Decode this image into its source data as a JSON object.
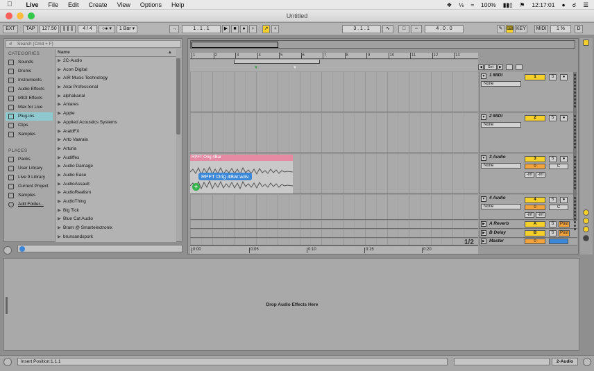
{
  "menubar": {
    "apple": "",
    "app": "Live",
    "items": [
      "File",
      "Edit",
      "Create",
      "View",
      "Options",
      "Help"
    ],
    "battery": "100%",
    "clock": "12:17:01"
  },
  "window": {
    "title": "Untitled"
  },
  "control": {
    "ext": "EXT",
    "tap": "TAP",
    "tempo": "127.50",
    "signature": "4 / 4",
    "quantize": "1 Bar",
    "position": "1 .   1 .   1",
    "loop_start": "3 .   1 .   1",
    "loop_length": "4 .   0 .   0",
    "key": "KEY",
    "midi": "MIDI",
    "cpu": "1 %",
    "d": "D"
  },
  "browser": {
    "search_placeholder": "Search (Cmd + F)",
    "categories_label": "CATEGORIES",
    "places_label": "PLACES",
    "name_col": "Name",
    "categories": [
      "Sounds",
      "Drums",
      "Instruments",
      "Audio Effects",
      "MIDI Effects",
      "Max for Live",
      "Plug-ins",
      "Clips",
      "Samples"
    ],
    "places": [
      "Packs",
      "User Library",
      "Live 9 Library",
      "Current Project",
      "Samples",
      "Add Folder..."
    ],
    "items": [
      "2C-Audio",
      "Acon Digital",
      "AIR Music Technology",
      "Akai Professional",
      "alphakanal",
      "Antares",
      "Apple",
      "Applied Acoustics Systems",
      "AraldFX",
      "Arto Vaarala",
      "Arturia",
      "Audiffex",
      "Audio Damage",
      "Audio Ease",
      "AudioAssault",
      "AudioRealism",
      "AudioThing",
      "Big Tick",
      "Blue Cat Audio",
      "Bram @ Smartelectronix",
      "brunsandspork"
    ]
  },
  "arrangement": {
    "bars": [
      "1",
      "2",
      "3",
      "4",
      "5",
      "6",
      "7",
      "8",
      "9",
      "10",
      "11",
      "12",
      "13"
    ],
    "times": [
      "0:00",
      "0:05",
      "0:10",
      "0:15",
      "0:20"
    ],
    "page": "1/2",
    "set": "Set",
    "clip_name": "RPFT Orig 4Bar",
    "drag_label": "RPFT Orig 4Bar.wav"
  },
  "tracks": [
    {
      "name": "1 MIDI",
      "input": "None",
      "num": "1"
    },
    {
      "name": "2 MIDI",
      "input": "None",
      "num": "2"
    },
    {
      "name": "3 Audio",
      "input": "None",
      "num": "3",
      "vol": "0",
      "pan": "C",
      "inf1": "-inf",
      "inf2": "-inf"
    },
    {
      "name": "4 Audio",
      "input": "None",
      "num": "4",
      "vol": "0",
      "pan": "C",
      "inf1": "-inf",
      "inf2": "-inf"
    }
  ],
  "returns": [
    {
      "name": "A Reverb",
      "letter": "A",
      "post": "Post"
    },
    {
      "name": "B Delay",
      "letter": "B",
      "post": "Post"
    },
    {
      "name": "Master",
      "vol": "0"
    }
  ],
  "solo": "S",
  "detail": {
    "message": "Drop Audio Effects Here"
  },
  "status": {
    "text": "Insert Position:1.1.1",
    "track": "2-Audio"
  },
  "colors": {
    "accent": "#f5cf2a",
    "selection": "#8fc9cf",
    "clip": "#e68aa3",
    "drag": "#3c88d8"
  }
}
